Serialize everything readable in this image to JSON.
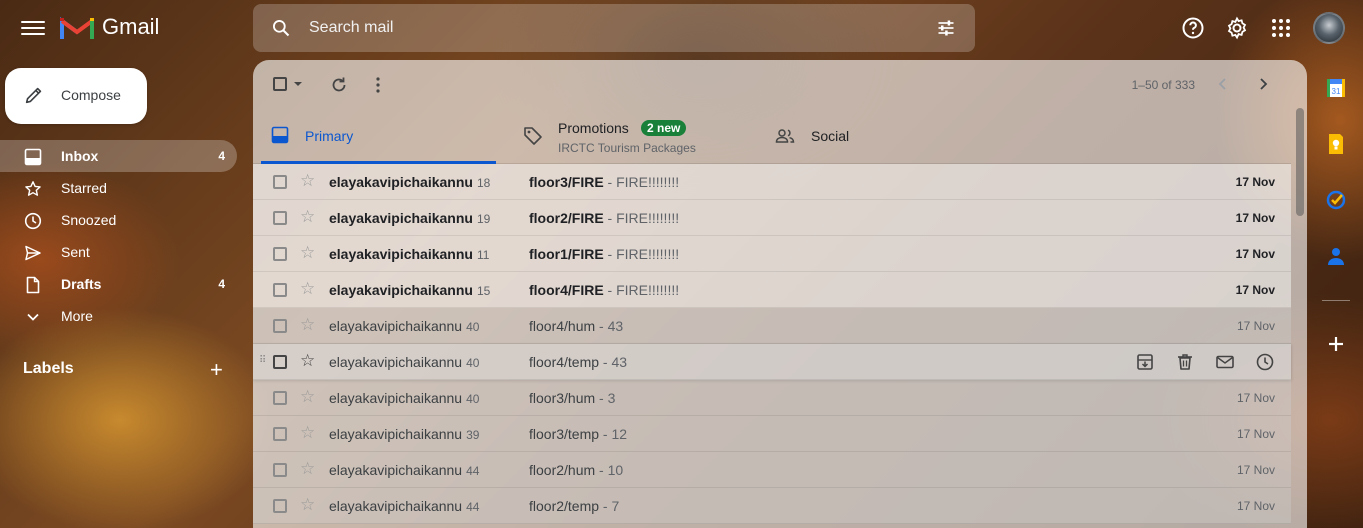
{
  "app": {
    "name": "Gmail"
  },
  "search": {
    "placeholder": "Search mail"
  },
  "compose": {
    "label": "Compose"
  },
  "nav": [
    {
      "label": "Inbox",
      "count": "4",
      "icon": "inbox-icon"
    },
    {
      "label": "Starred",
      "count": "",
      "icon": "star-icon"
    },
    {
      "label": "Snoozed",
      "count": "",
      "icon": "clock-icon"
    },
    {
      "label": "Sent",
      "count": "",
      "icon": "send-icon"
    },
    {
      "label": "Drafts",
      "count": "4",
      "icon": "file-icon"
    },
    {
      "label": "More",
      "count": "",
      "icon": "chevron-down-icon"
    }
  ],
  "labels": {
    "heading": "Labels",
    "add": "+"
  },
  "pager": {
    "range": "1–50 of 333"
  },
  "tabs": {
    "primary": "Primary",
    "promotions": "Promotions",
    "promotions_badge": "2 new",
    "promotions_sub": "IRCTC Tourism Packages",
    "social": "Social"
  },
  "emails": [
    {
      "sender": "elayakavipichaikannu",
      "count": "18",
      "subject": "floor3/FIRE",
      "snippet": " - FIRE!!!!!!!!",
      "date": "17 Nov"
    },
    {
      "sender": "elayakavipichaikannu",
      "count": "19",
      "subject": "floor2/FIRE",
      "snippet": " - FIRE!!!!!!!!",
      "date": "17 Nov"
    },
    {
      "sender": "elayakavipichaikannu",
      "count": "11",
      "subject": "floor1/FIRE",
      "snippet": " - FIRE!!!!!!!!",
      "date": "17 Nov"
    },
    {
      "sender": "elayakavipichaikannu",
      "count": "15",
      "subject": "floor4/FIRE",
      "snippet": " - FIRE!!!!!!!!",
      "date": "17 Nov"
    },
    {
      "sender": "elayakavipichaikannu",
      "count": "40",
      "subject": "floor4/hum",
      "snippet": " - 43",
      "date": "17 Nov"
    },
    {
      "sender": "elayakavipichaikannu",
      "count": "40",
      "subject": "floor4/temp",
      "snippet": " - 43",
      "date": "17 Nov"
    },
    {
      "sender": "elayakavipichaikannu",
      "count": "40",
      "subject": "floor3/hum",
      "snippet": " - 3",
      "date": "17 Nov"
    },
    {
      "sender": "elayakavipichaikannu",
      "count": "39",
      "subject": "floor3/temp",
      "snippet": " - 12",
      "date": "17 Nov"
    },
    {
      "sender": "elayakavipichaikannu",
      "count": "44",
      "subject": "floor2/hum",
      "snippet": " - 10",
      "date": "17 Nov"
    },
    {
      "sender": "elayakavipichaikannu",
      "count": "44",
      "subject": "floor2/temp",
      "snippet": " - 7",
      "date": "17 Nov"
    }
  ],
  "colors": {
    "accent": "#0b57d0",
    "badge": "#188038"
  }
}
